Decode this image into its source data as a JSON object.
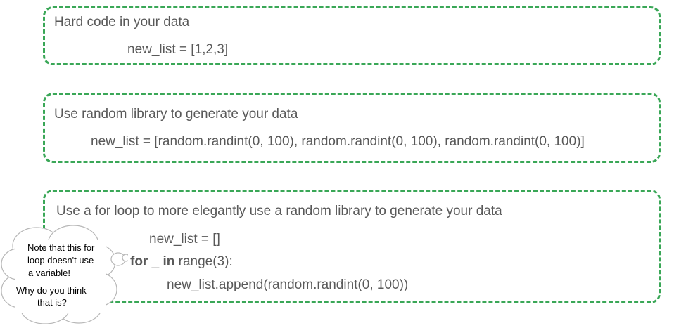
{
  "boxes": [
    {
      "heading": "Hard code in your data",
      "code": "new_list = [1,2,3]"
    },
    {
      "heading": "Use random library to generate your data",
      "code": "new_list = [random.randint(0, 100), random.randint(0, 100), random.randint(0, 100)]"
    },
    {
      "heading": "Use a for loop to more elegantly use a random library to generate your data",
      "code_line1": "new_list = []",
      "code_line2_kw1": "for",
      "code_line2_var": " _ ",
      "code_line2_kw2": "in",
      "code_line2_rest": " range(3):",
      "code_line3": "new_list.append(random.randint(0, 100))"
    }
  ],
  "note": {
    "line1": "Note that this for",
    "line2": "loop doesn't use",
    "line3": "a variable!",
    "line4": "Why do you think",
    "line5": "that is?"
  },
  "colors": {
    "border": "#3aa757",
    "text": "#595959",
    "cloud_stroke": "#b7b7b7"
  }
}
